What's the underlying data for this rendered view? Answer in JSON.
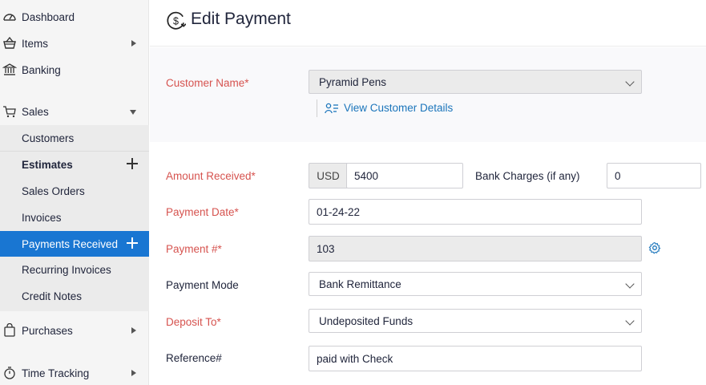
{
  "sidebar": {
    "top_items": [
      {
        "label": "Dashboard",
        "icon": "dashboard-icon"
      },
      {
        "label": "Items",
        "icon": "basket-icon"
      },
      {
        "label": "Banking",
        "icon": "bank-icon"
      }
    ],
    "sales": {
      "label": "Sales",
      "icon": "cart-icon"
    },
    "sales_items": [
      {
        "label": "Customers"
      },
      {
        "label": "Estimates"
      },
      {
        "label": "Sales Orders"
      },
      {
        "label": "Invoices"
      },
      {
        "label": "Payments Received"
      },
      {
        "label": "Recurring Invoices"
      },
      {
        "label": "Credit Notes"
      }
    ],
    "bottom_items": [
      {
        "label": "Purchases",
        "icon": "bag-icon"
      },
      {
        "label": "Time Tracking",
        "icon": "stopwatch-icon"
      }
    ],
    "active_color": "#1976d2"
  },
  "header": {
    "title": "Edit Payment",
    "icon": "payment-icon"
  },
  "form": {
    "customer_name": {
      "label": "Customer Name*",
      "value": "Pyramid Pens",
      "link": "View Customer Details"
    },
    "amount_received": {
      "label": "Amount Received*",
      "currency": "USD",
      "value": "5400"
    },
    "bank_charges": {
      "label": "Bank Charges (if any)",
      "value": "0"
    },
    "payment_date": {
      "label": "Payment Date*",
      "value": "01-24-22"
    },
    "payment_number": {
      "label": "Payment #*",
      "value": "103"
    },
    "payment_mode": {
      "label": "Payment Mode",
      "value": "Bank Remittance"
    },
    "deposit_to": {
      "label": "Deposit To*",
      "value": "Undeposited Funds"
    },
    "reference": {
      "label": "Reference#",
      "value": "paid with Check"
    }
  },
  "colors": {
    "required_label": "#d6534f",
    "link": "#1b75bb"
  }
}
